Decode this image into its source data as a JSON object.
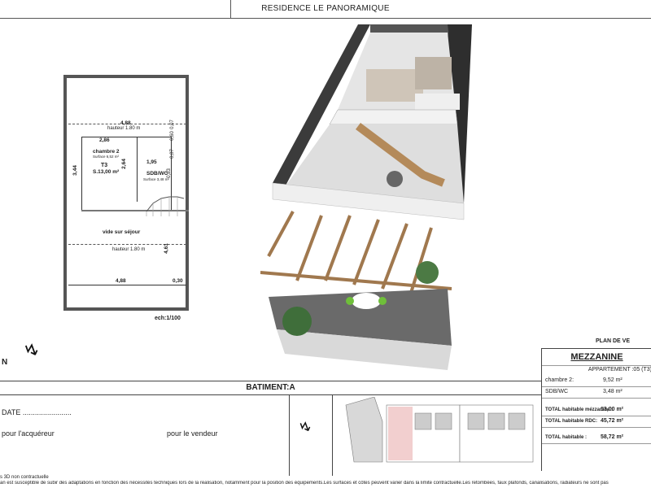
{
  "header": {
    "title": "RESIDENCE LE PANORAMIQUE"
  },
  "plan": {
    "dim_top_width": "4,88",
    "hauteur_top": "hauteur 1.80 m",
    "dim_007": "0,07",
    "dim_060": "0,60",
    "dim_286": "2,86",
    "chambre2": "chambre 2",
    "chambre2_surface": "Surface 6,52 m²",
    "dim_195": "1,95",
    "dim_007b": "0,07",
    "t3": "T3",
    "t3_surface": "S.13,00 m²",
    "dim_264": "2,64",
    "sdb": "SDB/WC",
    "sdb_surface": "Surface 3,48 m²",
    "dim_083": "0,83",
    "dim_344": "3,44",
    "vide": "vide sur séjour",
    "hauteur_mid": "hauteur 1.80 m",
    "dim_461": "4,61",
    "dim_bottom_width": "4,88",
    "dim_030": "0,30",
    "scale": "ech:1/100"
  },
  "right_panel": {
    "plan_label": "PLAN DE VE",
    "level": "MEZZANINE",
    "apartment": "APPARTEMENT :05 (T3)",
    "rows": [
      {
        "label": "chambre 2:",
        "value": "9,52 m²"
      },
      {
        "label": "SDB/WC",
        "value": "3,48 m²"
      }
    ],
    "totals": [
      {
        "label": "TOTAL habitable mézzanine :",
        "value": "13,00 m²"
      },
      {
        "label": "TOTAL habitable RDC:",
        "value": "45,72 m²"
      },
      {
        "label": "TOTAL habitable :",
        "value": "58,72 m²"
      }
    ]
  },
  "bottom": {
    "batiment": "BATIMENT:A",
    "date": "DATE ........................",
    "acquereur": "pour l'acquéreur",
    "vendeur": "pour le vendeur"
  },
  "footer": {
    "line1": "s 3D non contractuelle",
    "line2": "an est susceptible de subir des adaptations en fonction des nécessités techniques lors de la réalisation, notamment pour la position des équipements.Les surfaces et côtes peuvent varier dans la limite contractuelle.Les retombées, faux plafonds, canalisations, radiateurs ne sont pas"
  },
  "colors": {
    "wall": "#555555",
    "wood": "#a0784e",
    "floor_gray": "#6a6a6a"
  }
}
